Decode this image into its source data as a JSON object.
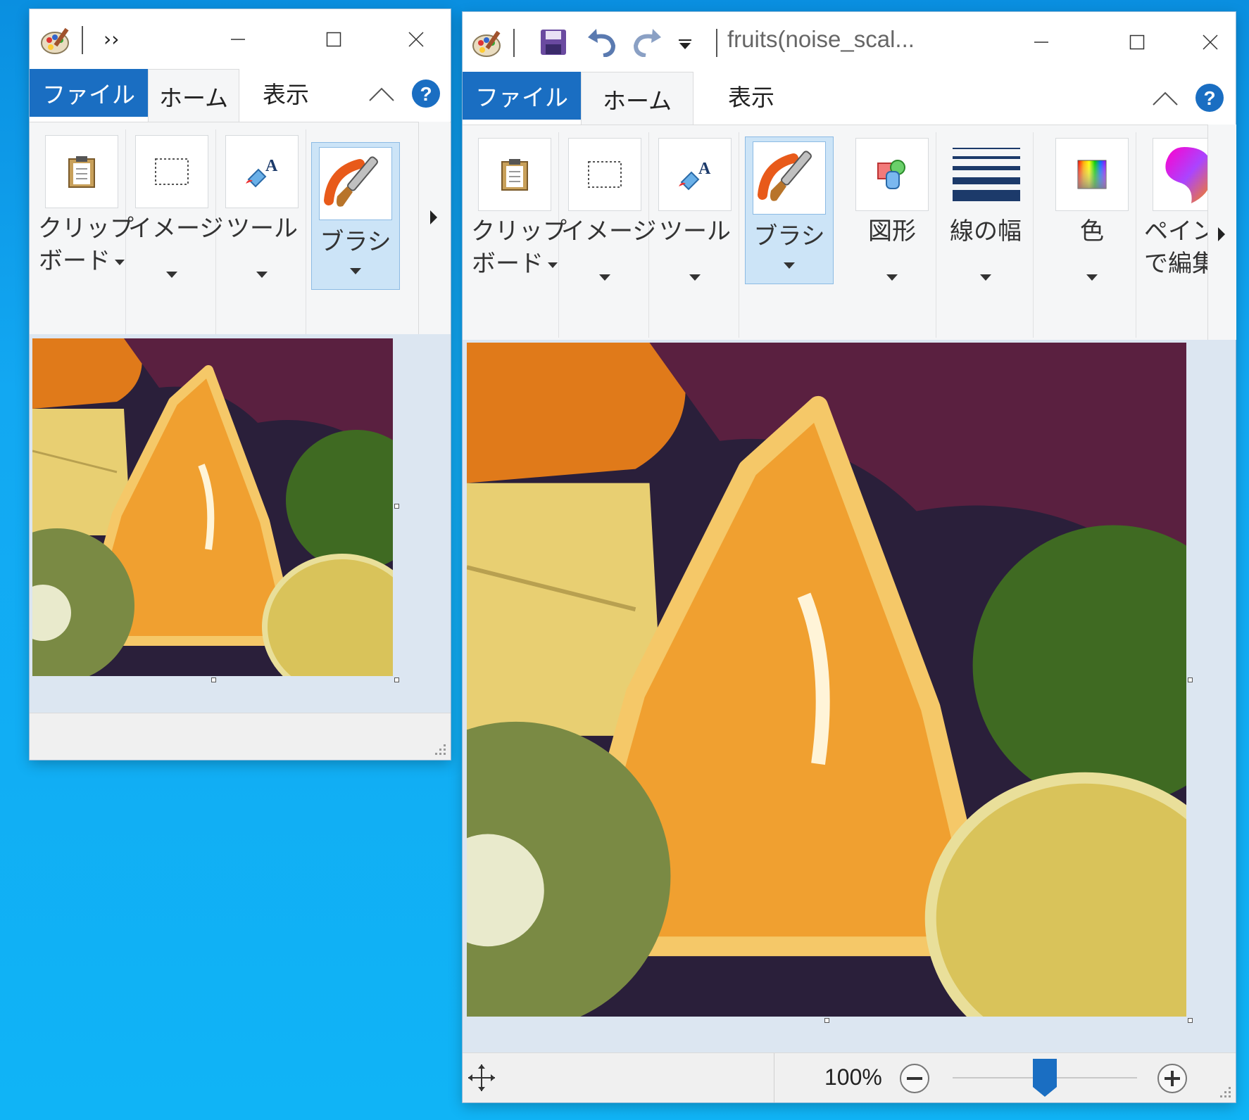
{
  "desktop": {
    "color": "#0fb0f5"
  },
  "window_small": {
    "tabs": {
      "file": "ファイル",
      "home": "ホーム",
      "view": "表示"
    },
    "overflow": "››",
    "groups": {
      "clipboard": [
        "クリップ",
        "ボード"
      ],
      "image": "イメージ",
      "tools": "ツール",
      "brushes": "ブラシ"
    },
    "help": "?"
  },
  "window_large": {
    "title": "fruits(noise_scal...",
    "tabs": {
      "file": "ファイル",
      "home": "ホーム",
      "view": "表示"
    },
    "groups": {
      "clipboard": [
        "クリップ",
        "ボード"
      ],
      "image": "イメージ",
      "tools": "ツール",
      "brushes": "ブラシ",
      "shapes": "図形",
      "size": "線の幅",
      "colors": "色",
      "paint3d": [
        "ペイン",
        "で編集"
      ]
    },
    "help": "?",
    "status": {
      "zoom": "100%",
      "zoom_level": 0.5
    }
  },
  "colors": {
    "accent": "#1a6ec2",
    "ribbon_bg": "#f5f6f7",
    "selected": "#cce4f7",
    "canvas_bg": "#dce6f1"
  },
  "icons": [
    "paint-app-icon",
    "save-icon",
    "undo-icon",
    "redo-icon",
    "quick-access-dropdown-icon",
    "minimize-icon",
    "maximize-icon",
    "close-icon",
    "collapse-ribbon-icon",
    "help-icon",
    "clipboard-icon",
    "select-icon",
    "tools-icon",
    "brush-icon",
    "shapes-icon",
    "line-width-icon",
    "colors-icon",
    "paint3d-icon",
    "move-icon",
    "zoom-out-icon",
    "zoom-in-icon",
    "resize-grip-icon"
  ]
}
